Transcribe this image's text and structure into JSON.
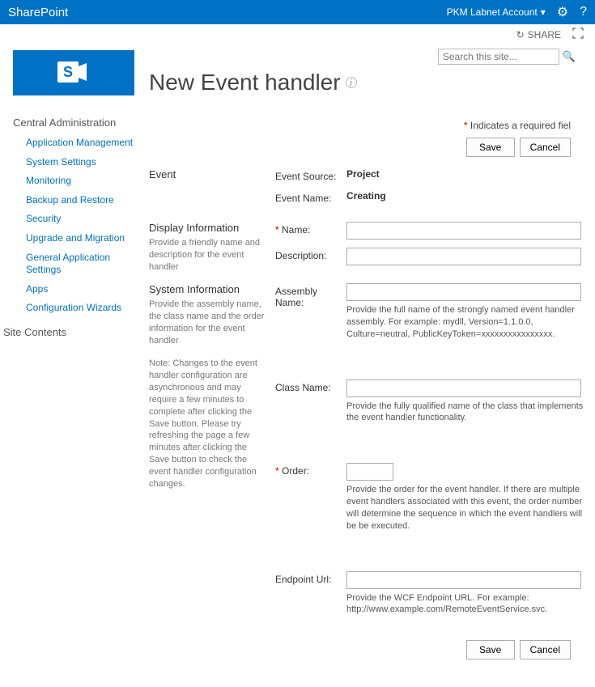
{
  "ribbon": {
    "brand": "SharePoint",
    "account": "PKM Labnet Account"
  },
  "subbar": {
    "share": "SHARE"
  },
  "search": {
    "placeholder": "Search this site..."
  },
  "page": {
    "title": "New Event handler"
  },
  "requiredNote": {
    "asterisk": "*",
    "text": " Indicates a required fiel"
  },
  "buttons": {
    "save": "Save",
    "cancel": "Cancel"
  },
  "nav": {
    "heading": "Central Administration",
    "items": [
      "Application Management",
      "System Settings",
      "Monitoring",
      "Backup and Restore",
      "Security",
      "Upgrade and Migration",
      "General Application Settings",
      "Apps",
      "Configuration Wizards"
    ],
    "siteContents": "Site Contents"
  },
  "sections": {
    "event": {
      "title": "Event",
      "sourceLabel": "Event Source:",
      "sourceValue": "Project",
      "nameLabel": "Event Name:",
      "nameValue": "Creating"
    },
    "display": {
      "title": "Display Information",
      "desc": "Provide a friendly name and description for the event handler",
      "nameLabel": "Name:",
      "descLabel": "Description:"
    },
    "system": {
      "title": "System Information",
      "desc": "Provide the assembly name, the class name and the order information for the event handler",
      "note": "Note: Changes to the event handler configuration are asynchronous and may require a few minutes to complete after clicking the Save button. Please try refreshing the page a few minutes after clicking the Save button to check the event handler configuration changes.",
      "assemblyLabel": "Assembly Name:",
      "assemblyHelp": "Provide the full name of the strongly named event handler assembly. For example: mydll, Version=1.1.0.0, Culture=neutral, PublicKeyToken=xxxxxxxxxxxxxxxx.",
      "classLabel": "Class Name:",
      "classHelp": "Provide the fully qualified name of the class that implements the event handler functionality.",
      "orderLabel": "Order:",
      "orderHelp": "Provide the order for the event handler. If there are multiple event handlers associated with this event, the order number will determine the sequence in which the event handlers will be be executed.",
      "endpointLabel": "Endpoint Url:",
      "endpointHelp": "Provide the WCF Endpoint URL. For example: http://www.example.com/RemoteEventService.svc."
    }
  }
}
